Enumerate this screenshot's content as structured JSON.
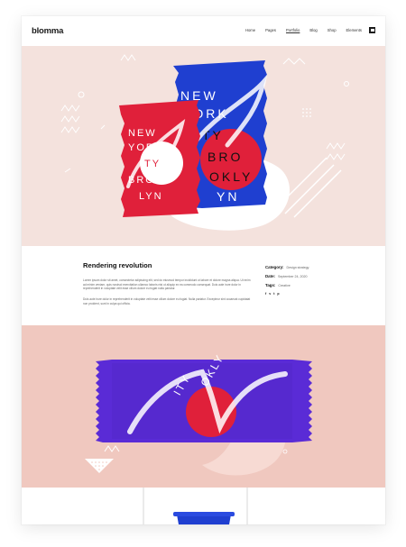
{
  "header": {
    "logo": "blomma",
    "nav": [
      "Home",
      "Pages",
      "Portfolio",
      "Blog",
      "Shop",
      "Elements"
    ],
    "active_nav": "Portfolio"
  },
  "project": {
    "title": "Rendering revolution",
    "paragraph1": "Lorem ipsum dolor sit amet, consectetur adipiscing elit, sed do eiusmod tempor incididunt ut labore et dolore magna aliqua. Ut enim ad minim veniam, quis nostrud exercitation ullamco laboris nisi ut aliquip ex ea commodo consequat. Duis aute irure dolor in reprehenderit in voluptate velit esse cillum dolore eu fugiat nulla pariatur.",
    "paragraph2": "Duis aute irure dolor in reprehenderit in voluptate velit esse cillum dolore eu fugiat. Nulla pariatur. Excepteur sint occaecat cupidatat non proident, sunt in culpa qui officia.",
    "category_label": "Category:",
    "category_value": "Design strategy",
    "date_label": "Date:",
    "date_value": "September 24, 2020",
    "tags_label": "Tags:",
    "tags_value": "Creative",
    "socials": [
      "f",
      "v",
      "t",
      "p"
    ]
  },
  "colors": {
    "hero_bg": "#f4e2dd",
    "pink_bg": "#f0c8bf",
    "red": "#e0203a",
    "blue": "#1f3fd0",
    "purple": "#5a2bd6",
    "dark": "#1a1a1a"
  }
}
